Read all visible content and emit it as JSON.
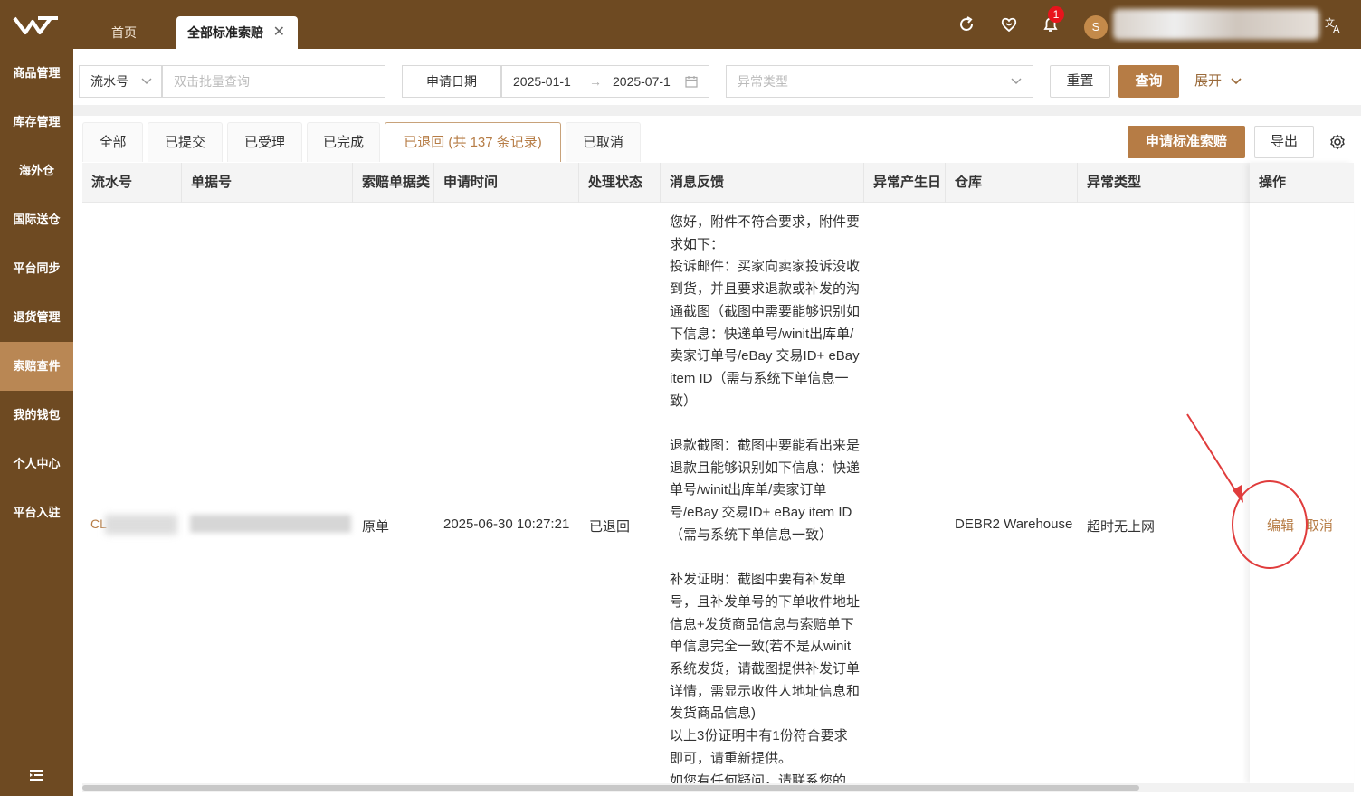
{
  "header": {
    "tabs": [
      {
        "label": "首页"
      },
      {
        "label": "全部标准索赔"
      }
    ],
    "notification_count": "1",
    "avatar_letter": "S"
  },
  "sidebar": {
    "items": [
      {
        "label": "商品管理"
      },
      {
        "label": "库存管理"
      },
      {
        "label": "海外仓"
      },
      {
        "label": "国际送仓"
      },
      {
        "label": "平台同步"
      },
      {
        "label": "退货管理"
      },
      {
        "label": "索赔查件"
      },
      {
        "label": "我的钱包"
      },
      {
        "label": "个人中心"
      },
      {
        "label": "平台入驻"
      }
    ]
  },
  "filters": {
    "field_select": "流水号",
    "batch_placeholder": "双击批量查询",
    "date_label": "申请日期",
    "date_start": "2025-01-1",
    "date_arrow": "→",
    "date_end": "2025-07-1",
    "exception_placeholder": "异常类型",
    "reset_label": "重置",
    "query_label": "查询",
    "expand_label": "展开"
  },
  "status_tabs": [
    {
      "label": "全部"
    },
    {
      "label": "已提交"
    },
    {
      "label": "已受理"
    },
    {
      "label": "已完成"
    },
    {
      "label": "已退回 (共 137 条记录)"
    },
    {
      "label": "已取消"
    }
  ],
  "actions": {
    "apply_label": "申请标准索赔",
    "export_label": "导出"
  },
  "table": {
    "columns": [
      "流水号",
      "单据号",
      "索赔单据类",
      "申请时间",
      "处理状态",
      "消息反馈",
      "异常产生日",
      "仓库",
      "异常类型",
      "操作"
    ],
    "row": {
      "serial_prefix": "CL",
      "doc_type": "原单",
      "apply_time": "2025-06-30 10:27:21",
      "status": "已退回",
      "message": [
        "您好，附件不符合要求，附件要求如下：",
        "投诉邮件：买家向卖家投诉没收到货，并且要求退款或补发的沟通截图（截图中需要能够识别如下信息：快递单号/winit出库单/卖家订单号/eBay 交易ID+ eBay item ID（需与系统下单信息一致）",
        "",
        "退款截图：截图中要能看出来是退款且能够识别如下信息：快递单号/winit出库单/卖家订单号/eBay 交易ID+ eBay item ID（需与系统下单信息一致）",
        "",
        "补发证明：截图中要有补发单号，且补发单号的下单收件地址信息+发货商品信息与索赔单下单信息完全一致(若不是从winit系统发货，请截图提供补发订单详情，需显示收件人地址信息和发货商品信息)",
        "以上3份证明中有1份符合要求即可，请重新提供。",
        "如您有任何疑问，请联系您的"
      ],
      "warehouse": "DEBR2 Warehouse",
      "exception_type": "超时无上网",
      "op_edit": "编辑",
      "op_cancel": "取消"
    }
  }
}
